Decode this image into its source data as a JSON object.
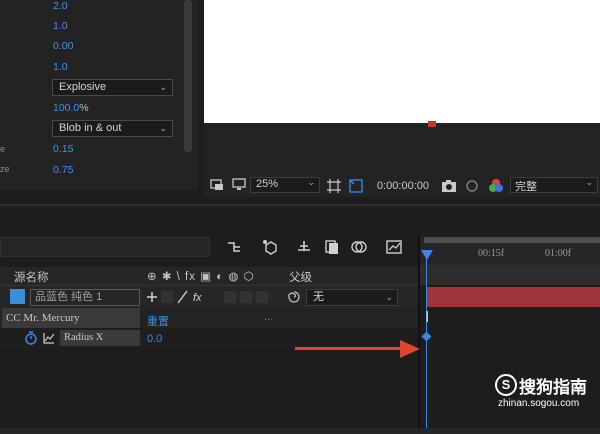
{
  "effect_controls": {
    "values": [
      {
        "label": "",
        "value": "2.0"
      },
      {
        "label": "",
        "value": "1.0"
      },
      {
        "label": "",
        "value": "0.00"
      },
      {
        "label": "",
        "value": "1.0"
      }
    ],
    "animation_select": "Explosive",
    "percent_value": "100.0",
    "percent_suffix": "%",
    "blob_select": "Blob in & out",
    "value_a": "0.15",
    "value_b": "0.75",
    "label_a": "e",
    "label_b": "ze"
  },
  "viewer": {
    "zoom": "25%",
    "timecode": "0:00:00:00",
    "quality": "完整"
  },
  "timeline": {
    "ruler_labels": [
      "00:15f",
      "01:00f"
    ],
    "header": {
      "source_name": "源名称",
      "switches": "⊕ ✱ \\ fx ▣ ◐ ◍ ⬡",
      "parent": "父级"
    },
    "layer": {
      "name": "品蓝色 纯色 1",
      "parent": "无"
    },
    "effect": {
      "name": "CC Mr. Mercury",
      "reset": "重置",
      "dots": "..."
    },
    "property": {
      "name": "Radius X",
      "value": "0.0"
    }
  },
  "watermark": {
    "logo": "S",
    "text": "搜狗指南",
    "url": "zhinan.sogou.com"
  },
  "colors": {
    "accent_blue": "#3a8ee6",
    "layer_bar": "#a0343a",
    "arrow": "#e2452f"
  }
}
